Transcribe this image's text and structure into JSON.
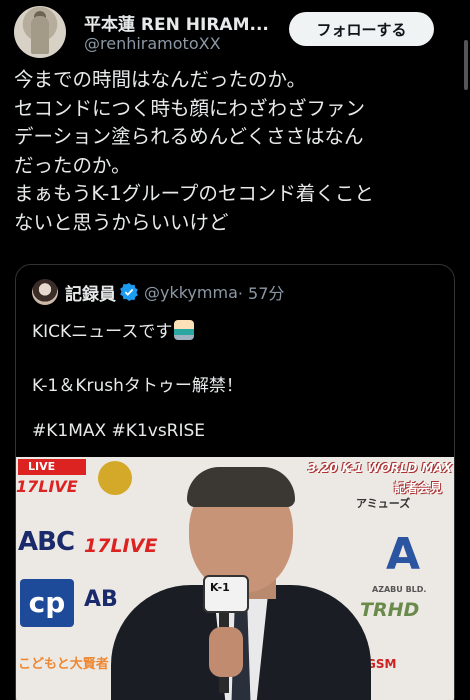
{
  "author": {
    "name": "平本蓮 REN HIRAM...",
    "handle": "@renhiramotoXX"
  },
  "follow_label": "フォローする",
  "tweet_lines": [
    "今までの時間はなんだったのか。",
    "セコンドにつく時も顔にわざわざファン",
    "デーション塗られるめんどくささはなん",
    "だったのか。",
    "まぁもうK-1グループのセコンド着くこと",
    "ないと思うからいいけど"
  ],
  "quote": {
    "name": "記録員",
    "handle": "@ykkymma",
    "time": "· 57分",
    "lines": [
      "KICKニュースです",
      "K-1＆Krushタトゥー解禁！",
      "#K1MAX #K1vsRISE"
    ],
    "emoji_icon": "technologist-emoji"
  },
  "photo": {
    "live_badge": "LIVE",
    "live_logo": "17LIVE",
    "abc": "ABC",
    "live_logo2": "17LIVE",
    "cp": "cp",
    "abc2": "AB",
    "event_title": "3.20 K-1 WORLD MAX",
    "press": "記者会見",
    "amuse": "アミューズ",
    "trhd": "HD",
    "trhd2": "TRHD",
    "azabu": "AZABU BLD.",
    "gsm": "GSM",
    "big_a": "A",
    "kids": "こどもと大賢者",
    "mic_label": "K-1"
  },
  "colors": {
    "background": "#000000",
    "text": "#e7e9ea",
    "secondary": "#8b98a5",
    "verified": "#1d9bf0",
    "border": "#2f3336"
  }
}
